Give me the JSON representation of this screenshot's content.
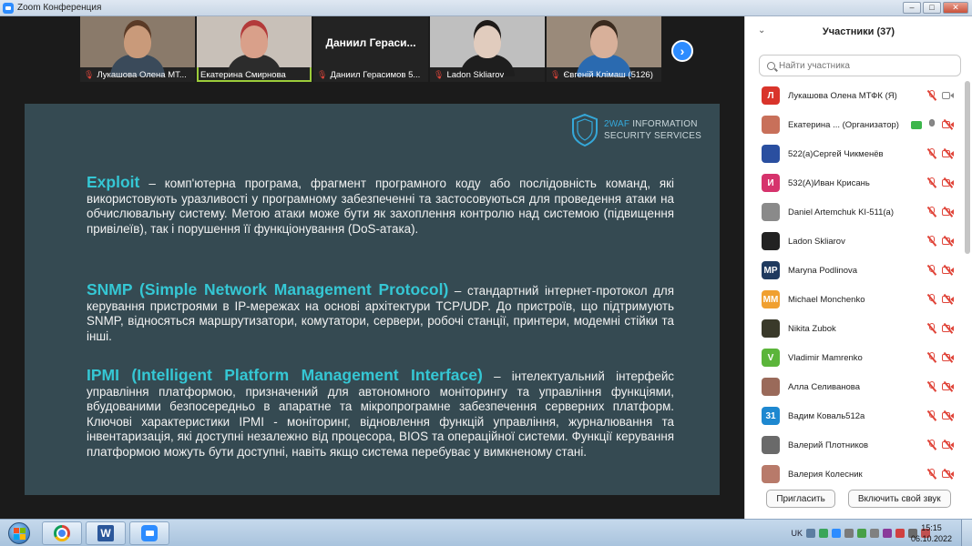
{
  "window": {
    "title": "Zoom Конференция",
    "min": "–",
    "max": "□",
    "close": "✕"
  },
  "thumbnails": [
    {
      "name": "Лукашова Олена МТ...",
      "muted": true,
      "skin": "#c99a7a",
      "hair": "#5a3a26",
      "shirt": "#3a4a5a",
      "bg": "#8a7a6a"
    },
    {
      "name": "Екатерина Смирнова",
      "muted": false,
      "skin": "#d9a08a",
      "hair": "#b33a3a",
      "shirt": "#2c2c2c",
      "bg": "#c8c0b8",
      "active": true
    },
    {
      "name": "Даниил Герасимов 5...",
      "muted": true,
      "overlay": "Даниил Гераси...",
      "bg": "#232323"
    },
    {
      "name": "Ladon Skliarov",
      "muted": true,
      "skin": "#e1ccbe",
      "hair": "#1e1a18",
      "shirt": "#1e1e1e",
      "bg": "#bfbfbf"
    },
    {
      "name": "Євгеній Клімаш (5126)",
      "muted": true,
      "skin": "#d8b09a",
      "hair": "#3a2a1e",
      "shirt": "#2a6ab0",
      "bg": "#9a8a7a"
    }
  ],
  "next_arrow": "›",
  "slide": {
    "logo_line1_acc": "2WAF",
    "logo_line1_rest": " INFORMATION",
    "logo_line2": "SECURITY SERVICES",
    "p1_term": "Exploit",
    "p1_text": " – комп'ютерна програма, фрагмент програмного коду або послідовність команд, які використовують уразливості у програмному забезпеченні та застосовуються для проведення атаки на обчислювальну систему. Метою атаки може бути як захоплення контролю над системою (підвищення привілеїв), так і порушення її функціонування (DoS-атака).",
    "p2_term": "SNMP (Simple Network Management Protocol)",
    "p2_text": " – стандартний інтернет-протокол для керування пристроями в IP-мережах на основі архітектури TCP/UDP. До пристроїв, що підтримують SNMP, відносяться маршрутизатори, комутатори, сервери, робочі станції, принтери, модемні стійки та інші.",
    "p3_term": "IPMI (Intelligent Platform Management Interface)",
    "p3_text": " – інтелектуальний інтерфейс управління платформою, призначений для автономного моніторингу та управління функціями, вбудованими безпосередньо в апаратне та мікропрограмне забезпечення серверних платформ. Ключові характеристики IPMI - моніторинг, відновлення функцій управління, журналювання та інвентаризація, які доступні незалежно від процесора, BIOS та операційної системи. Функції керування платформою можуть бути доступні, навіть якщо система перебуває у вимкненому стані."
  },
  "panel": {
    "title": "Участники (37)",
    "chev": "⌄",
    "search_placeholder": "Найти участника",
    "participants": [
      {
        "name": "Лукашова Олена МТФК (Я)",
        "initial": "Л",
        "color": "#d9342b",
        "mic": "muted",
        "cam": "on"
      },
      {
        "name": "Екатерина ... (Организатор)",
        "initial": "",
        "color": "#c8705a",
        "mic": "on",
        "cam": "off",
        "share": true
      },
      {
        "name": "522(а)Сергей Чикменёв",
        "initial": "",
        "color": "#2a4fa0",
        "mic": "muted",
        "cam": "off"
      },
      {
        "name": "532(А)Иван Крисань",
        "initial": "И",
        "color": "#d6336c",
        "mic": "muted",
        "cam": "off"
      },
      {
        "name": "Daniel Artemchuk KI-511(а)",
        "initial": "",
        "color": "#8a8a8a",
        "mic": "muted",
        "cam": "off"
      },
      {
        "name": "Ladon Skliarov",
        "initial": "",
        "color": "#222222",
        "mic": "muted",
        "cam": "off"
      },
      {
        "name": "Maryna Podlinova",
        "initial": "MP",
        "color": "#1f3a5f",
        "mic": "muted",
        "cam": "off"
      },
      {
        "name": "Michael Monchenko",
        "initial": "MM",
        "color": "#f0a030",
        "mic": "muted",
        "cam": "off"
      },
      {
        "name": "Nikita Zubok",
        "initial": "",
        "color": "#3a3a2a",
        "mic": "muted",
        "cam": "off"
      },
      {
        "name": "Vladimir Mamrenko",
        "initial": "V",
        "color": "#5bb53a",
        "mic": "muted",
        "cam": "off"
      },
      {
        "name": "Алла Селиванова",
        "initial": "",
        "color": "#9a6a5a",
        "mic": "muted",
        "cam": "off"
      },
      {
        "name": "Вадим Коваль512а",
        "initial": "31",
        "color": "#1e88d0",
        "mic": "muted",
        "cam": "off"
      },
      {
        "name": "Валерий Плотников",
        "initial": "",
        "color": "#6a6a6a",
        "mic": "muted",
        "cam": "off"
      },
      {
        "name": "Валерия Колесник",
        "initial": "",
        "color": "#b87a6a",
        "mic": "muted",
        "cam": "off"
      }
    ],
    "invite_label": "Пригласить",
    "unmute_label": "Включить свой звук"
  },
  "taskbar": {
    "word_letter": "W",
    "lang": "UK",
    "time": "15:15",
    "date": "06.10.2022"
  }
}
